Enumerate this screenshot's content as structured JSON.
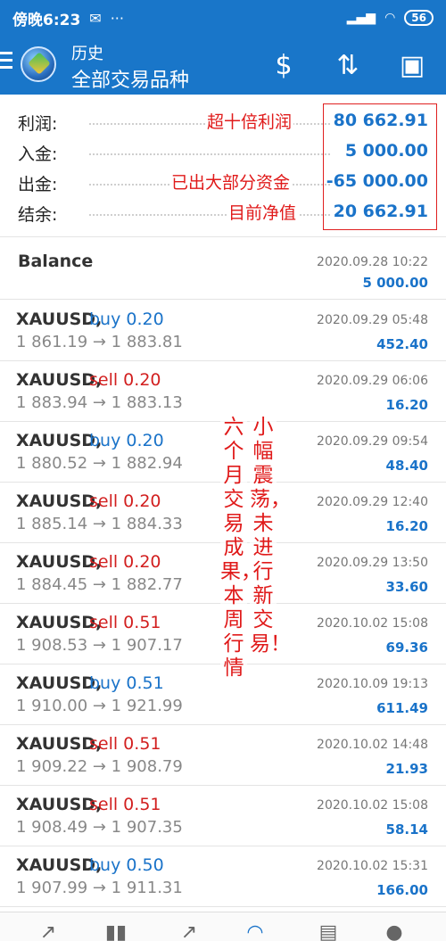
{
  "statusbar": {
    "time": "傍晚6:23",
    "battery": "56"
  },
  "header": {
    "title": "历史",
    "subtitle": "全部交易品种"
  },
  "summary": [
    {
      "label": "利润:",
      "value": "80 662.91",
      "note": "超十倍利润"
    },
    {
      "label": "入金:",
      "value": "5 000.00",
      "note": ""
    },
    {
      "label": "出金:",
      "value": "-65 000.00",
      "note": "已出大部分资金"
    },
    {
      "label": "结余:",
      "value": "20 662.91",
      "note": "目前净值"
    }
  ],
  "balance": {
    "name": "Balance",
    "date": "2020.09.28 10:22",
    "amount": "5 000.00"
  },
  "trades": [
    {
      "symbol": "XAUUSD,",
      "side": "buy 0.20",
      "type": "buy",
      "prices": "1 861.19 → 1 883.81",
      "date": "2020.09.29 05:48",
      "profit": "452.40"
    },
    {
      "symbol": "XAUUSD,",
      "side": "sell 0.20",
      "type": "sell",
      "prices": "1 883.94 → 1 883.13",
      "date": "2020.09.29 06:06",
      "profit": "16.20"
    },
    {
      "symbol": "XAUUSD,",
      "side": "buy 0.20",
      "type": "buy",
      "prices": "1 880.52 → 1 882.94",
      "date": "2020.09.29 09:54",
      "profit": "48.40"
    },
    {
      "symbol": "XAUUSD,",
      "side": "sell 0.20",
      "type": "sell",
      "prices": "1 885.14 → 1 884.33",
      "date": "2020.09.29 12:40",
      "profit": "16.20"
    },
    {
      "symbol": "XAUUSD,",
      "side": "sell 0.20",
      "type": "sell",
      "prices": "1 884.45 → 1 882.77",
      "date": "2020.09.29 13:50",
      "profit": "33.60"
    },
    {
      "symbol": "XAUUSD,",
      "side": "sell 0.51",
      "type": "sell",
      "prices": "1 908.53 → 1 907.17",
      "date": "2020.10.02 15:08",
      "profit": "69.36"
    },
    {
      "symbol": "XAUUSD,",
      "side": "buy 0.51",
      "type": "buy",
      "prices": "1 910.00 → 1 921.99",
      "date": "2020.10.09 19:13",
      "profit": "611.49"
    },
    {
      "symbol": "XAUUSD,",
      "side": "sell 0.51",
      "type": "sell",
      "prices": "1 909.22 → 1 908.79",
      "date": "2020.10.02 14:48",
      "profit": "21.93"
    },
    {
      "symbol": "XAUUSD,",
      "side": "sell 0.51",
      "type": "sell",
      "prices": "1 908.49 → 1 907.35",
      "date": "2020.10.02 15:08",
      "profit": "58.14"
    },
    {
      "symbol": "XAUUSD,",
      "side": "buy 0.50",
      "type": "buy",
      "prices": "1 907.99 → 1 911.31",
      "date": "2020.10.02 15:31",
      "profit": "166.00"
    }
  ],
  "annotation_columns": [
    "小幅震荡，未进行新交易！",
    "六个月交易成果，本周行情"
  ],
  "icons": {
    "app_logo": "metatrader-logo",
    "appbar": [
      "currency-exchange-icon",
      "sort-icon",
      "calendar-icon"
    ],
    "bottomnav": [
      "quotes-icon",
      "chart-icon",
      "trade-icon",
      "history-icon",
      "news-icon",
      "messages-icon"
    ],
    "bottomnav_active": "history-icon"
  },
  "colors": {
    "primary": "#1976c9",
    "profit": "#1a73c9",
    "sell": "#d21f1f",
    "annotation": "#e01a1a"
  }
}
